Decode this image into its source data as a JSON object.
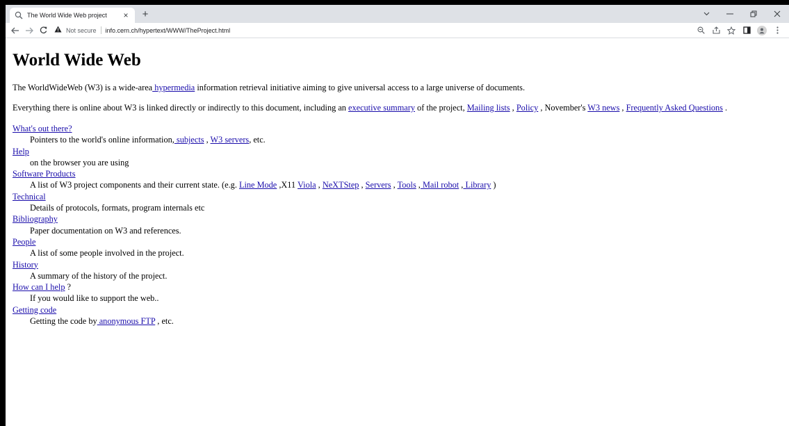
{
  "browser": {
    "tab_title": "The World Wide Web project",
    "tab_close": "×",
    "new_tab": "+",
    "not_secure": "Not secure",
    "url": "info.cern.ch/hypertext/WWW/TheProject.html"
  },
  "page": {
    "heading": "World Wide Web",
    "intro": {
      "t1": "The WorldWideWeb (W3) is a wide-area",
      "link_hypermedia": " hypermedia",
      "t2": " information retrieval initiative aiming to give universal access to a large universe of documents."
    },
    "summary": {
      "t1": "Everything there is online about W3 is linked directly or indirectly to this document, including an ",
      "link_exec": "executive summary",
      "t2": " of the project, ",
      "link_mailing": "Mailing lists",
      "t3": " , ",
      "link_policy": "Policy",
      "t4": " , November's ",
      "link_news": "W3 news",
      "t5": " , ",
      "link_faq": "Frequently Asked Questions",
      "t6": " ."
    },
    "items": [
      {
        "term": "What's out there?",
        "desc1": "Pointers to the world's online information,",
        "link1": " subjects",
        "desc2": " , ",
        "link2": "W3 servers",
        "desc3": ", etc."
      },
      {
        "term": "Help",
        "desc": "on the browser you are using"
      },
      {
        "term": "Software Products",
        "desc1": "A list of W3 project components and their current state. (e.g. ",
        "link_linemode": "Line Mode",
        "d2": " ,X11 ",
        "link_viola": "Viola",
        "d3": " , ",
        "link_nextstep": "NeXTStep",
        "d4": " , ",
        "link_servers": "Servers",
        "d5": " , ",
        "link_tools": "Tools",
        "d6": " ,",
        "link_mailrobot": " Mail robot",
        "d7": " ,",
        "link_library": " Library",
        "d8": " )"
      },
      {
        "term": "Technical",
        "desc": "Details of protocols, formats, program internals etc"
      },
      {
        "term": "Bibliography",
        "desc": "Paper documentation on W3 and references."
      },
      {
        "term": "People",
        "desc": "A list of some people involved in the project."
      },
      {
        "term": "History",
        "desc": "A summary of the history of the project."
      },
      {
        "term": "How can I help",
        "term_suffix": " ?",
        "desc": "If you would like to support the web.."
      },
      {
        "term": "Getting code",
        "desc1": "Getting the code by",
        "link1": " anonymous FTP",
        "desc2": " , etc."
      }
    ]
  }
}
